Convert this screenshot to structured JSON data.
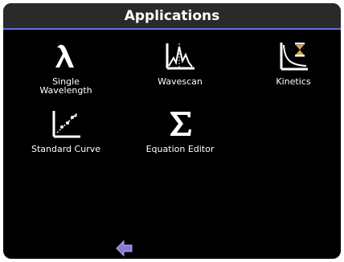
{
  "header": {
    "title": "Applications"
  },
  "apps": [
    {
      "label": "Single\nWavelength",
      "icon": "lambda-icon"
    },
    {
      "label": "Wavescan",
      "icon": "wavescan-icon"
    },
    {
      "label": "Kinetics",
      "icon": "kinetics-icon"
    },
    {
      "label": "Standard Curve",
      "icon": "standard-curve-icon"
    },
    {
      "label": "Equation Editor",
      "icon": "sigma-icon"
    }
  ],
  "footer": {
    "back_icon": "back-arrow-icon"
  },
  "colors": {
    "accent": "#5b74e4",
    "background": "#000000",
    "title_bar": "#2a2a2a",
    "arrow": "#8a7ad6"
  }
}
